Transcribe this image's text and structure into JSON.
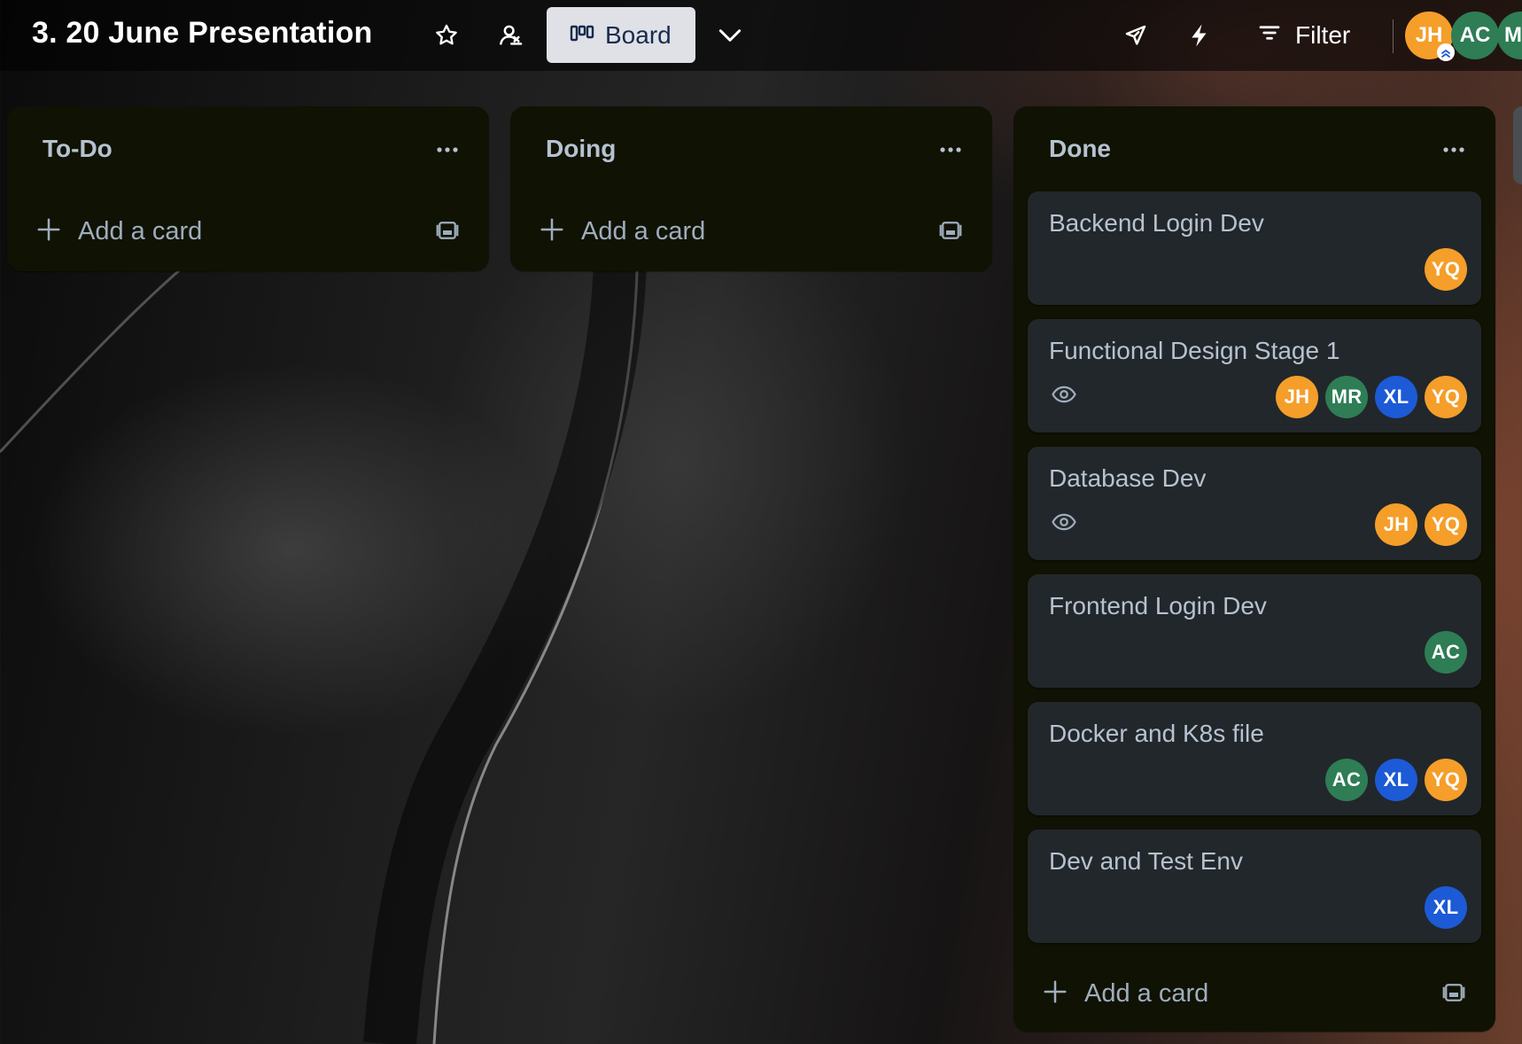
{
  "header": {
    "title": "3. 20 June Presentation",
    "icons": {
      "star": "star-icon",
      "visibility": "workspace-visible-icon",
      "view_switcher": "chevron-down-icon",
      "power_ups": "rocket-icon",
      "automation": "lightning-icon",
      "filter": "filter-icon"
    },
    "view_button_label": "Board",
    "filter_label": "Filter",
    "members": [
      {
        "initials": "JH",
        "color": "#f59e2a",
        "admin": true
      },
      {
        "initials": "AC",
        "color": "#2e7d55"
      },
      {
        "initials": "M",
        "color": "#2e7d55"
      }
    ]
  },
  "colors": {
    "list_bg": "#101204",
    "card_bg": "#22272b",
    "text": "#b6c2cf"
  },
  "lists": [
    {
      "title": "To-Do",
      "menu_icon": "more-horizontal-icon",
      "add_card_label": "Add a card",
      "cards": []
    },
    {
      "title": "Doing",
      "menu_icon": "more-horizontal-icon",
      "add_card_label": "Add a card",
      "cards": []
    },
    {
      "title": "Done",
      "menu_icon": "more-horizontal-icon",
      "add_card_label": "Add a card",
      "cards": [
        {
          "title": "Backend Login Dev",
          "watching": false,
          "members": [
            {
              "initials": "YQ",
              "color": "#f59e2a"
            }
          ]
        },
        {
          "title": "Functional Design Stage 1",
          "watching": true,
          "members": [
            {
              "initials": "JH",
              "color": "#f59e2a"
            },
            {
              "initials": "MR",
              "color": "#2e7d55"
            },
            {
              "initials": "XL",
              "color": "#1c5ad6"
            },
            {
              "initials": "YQ",
              "color": "#f59e2a"
            }
          ]
        },
        {
          "title": "Database Dev",
          "watching": true,
          "members": [
            {
              "initials": "JH",
              "color": "#f59e2a"
            },
            {
              "initials": "YQ",
              "color": "#f59e2a"
            }
          ]
        },
        {
          "title": "Frontend Login Dev",
          "watching": false,
          "members": [
            {
              "initials": "AC",
              "color": "#2e7d55"
            }
          ]
        },
        {
          "title": "Docker and K8s file",
          "watching": false,
          "members": [
            {
              "initials": "AC",
              "color": "#2e7d55"
            },
            {
              "initials": "XL",
              "color": "#1c5ad6"
            },
            {
              "initials": "YQ",
              "color": "#f59e2a"
            }
          ]
        },
        {
          "title": "Dev and Test Env",
          "watching": false,
          "members": [
            {
              "initials": "XL",
              "color": "#1c5ad6"
            }
          ]
        }
      ]
    }
  ]
}
